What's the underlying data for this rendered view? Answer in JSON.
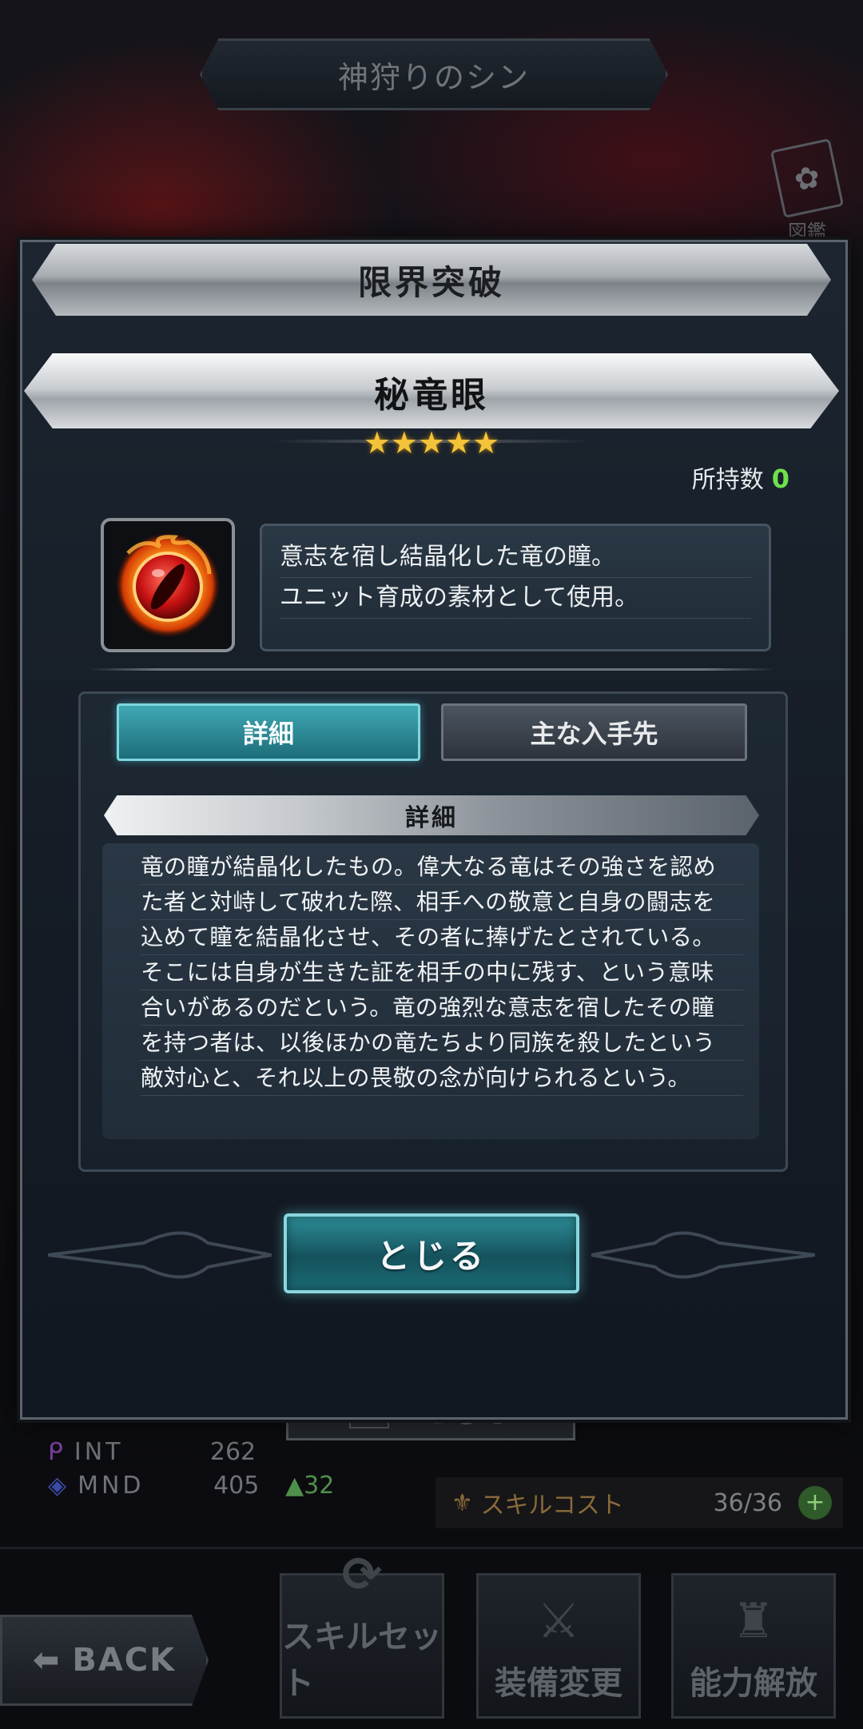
{
  "background": {
    "title": "神狩りのシン",
    "book_label": "図鑑",
    "stats": [
      {
        "key": "INT",
        "value": "262",
        "delta": ""
      },
      {
        "key": "MND",
        "value": "405",
        "delta": "▲32"
      }
    ],
    "skill_cost_label": "スキルコスト",
    "skill_cost_value": "36/36",
    "back_label": "BACK",
    "menu": [
      "スキルセット",
      "装備変更",
      "能力解放"
    ],
    "close_label": "とじる"
  },
  "dialog": {
    "header": "限界突破",
    "item_name": "秘竜眼",
    "stars": "★★★★★",
    "owned_label": "所持数",
    "owned_count": "0",
    "description_lines": [
      "意志を宿し結晶化した竜の瞳。",
      "ユニット育成の素材として使用。"
    ],
    "tabs": {
      "detail": "詳細",
      "source": "主な入手先"
    },
    "detail_header": "詳細",
    "detail_lines": [
      "竜の瞳が結晶化したもの。偉大なる竜はその強さを認め",
      "た者と対峙して破れた際、相手への敬意と自身の闘志を",
      "込めて瞳を結晶化させ、その者に捧げたとされている。",
      "そこには自身が生きた証を相手の中に残す、という意味",
      "合いがあるのだという。竜の強烈な意志を宿したその瞳",
      "を持つ者は、以後ほかの竜たちより同族を殺したという",
      "敵対心と、それ以上の畏敬の念が向けられるという。"
    ],
    "close_button": "とじる"
  },
  "colors": {
    "accent_teal": "#40a8b4",
    "star_gold": "#f3c43a",
    "owned_green": "#6ee04c"
  }
}
